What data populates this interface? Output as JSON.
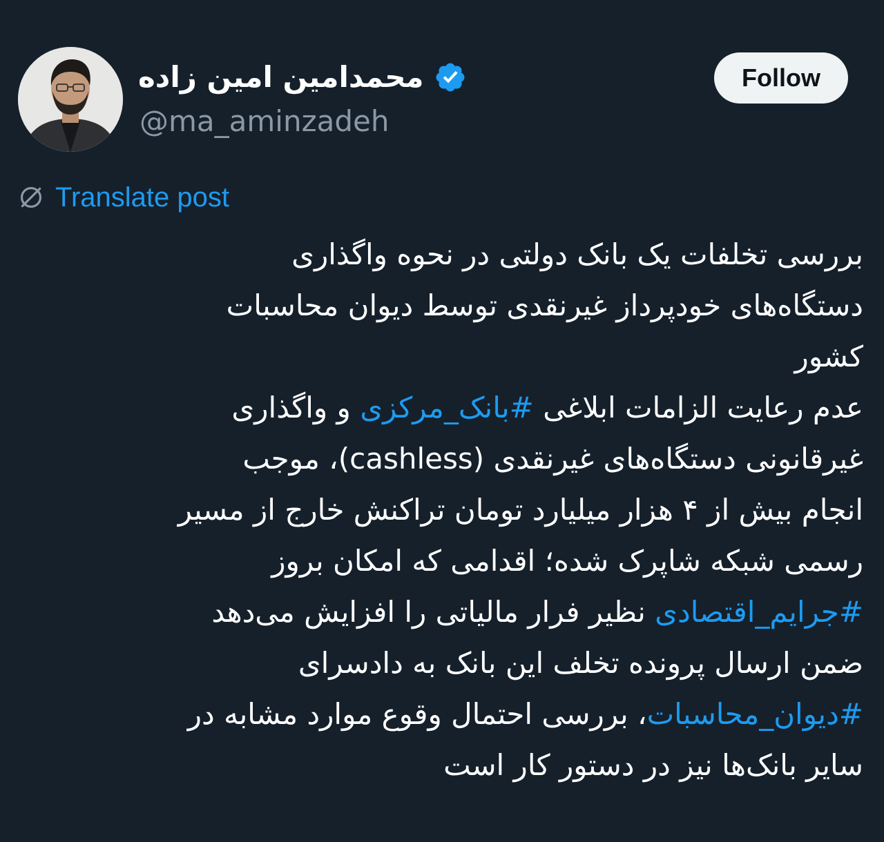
{
  "author": {
    "display_name": "محمدامین امین زاده",
    "handle": "@ma_aminzadeh",
    "verified_icon": "verified-badge-icon",
    "avatar_icon": "avatar"
  },
  "actions": {
    "follow_label": "Follow"
  },
  "translate": {
    "label": "Translate post",
    "icon": "globe-icon"
  },
  "post": {
    "paragraph1": [
      "بررسی تخلفات یک بانک دولتی در نحوه واگذاری",
      "دستگاه‌های خودپرداز غیرنقدی توسط دیوان محاسبات",
      "کشور"
    ],
    "p2_line1_before": " عدم رعایت الزامات ابلاغی ",
    "hashtag1": "#بانک_مرکزی",
    "p2_line1_after": " و واگذاری",
    "p2_line2": "غیرقانونی دستگاه‌های غیرنقدی (cashless)، موجب",
    "p2_line3": "انجام بیش از ۴ هزار میلیارد تومان تراکنش خارج از مسیر",
    "p2_line4": "رسمی شبکه شاپرک شده؛ اقدامی که امکان بروز",
    "hashtag2": "#جرایم_اقتصادی",
    "p2_line5_after": " نظیر فرار مالیاتی را افزایش می‌دهد",
    "p3_line1": "ضمن ارسال پرونده تخلف این بانک به دادسرای",
    "hashtag3": "#دیوان_محاسبات",
    "p3_line2_after": "، بررسی احتمال وقوع موارد مشابه در",
    "p3_line3": "سایر بانک‌ها نیز در دستور کار است"
  },
  "colors": {
    "background": "#15202b",
    "text": "#ffffff",
    "secondary_text": "#8b98a5",
    "link": "#1d9bf0",
    "follow_bg": "#eff3f4",
    "follow_text": "#0f1419"
  }
}
